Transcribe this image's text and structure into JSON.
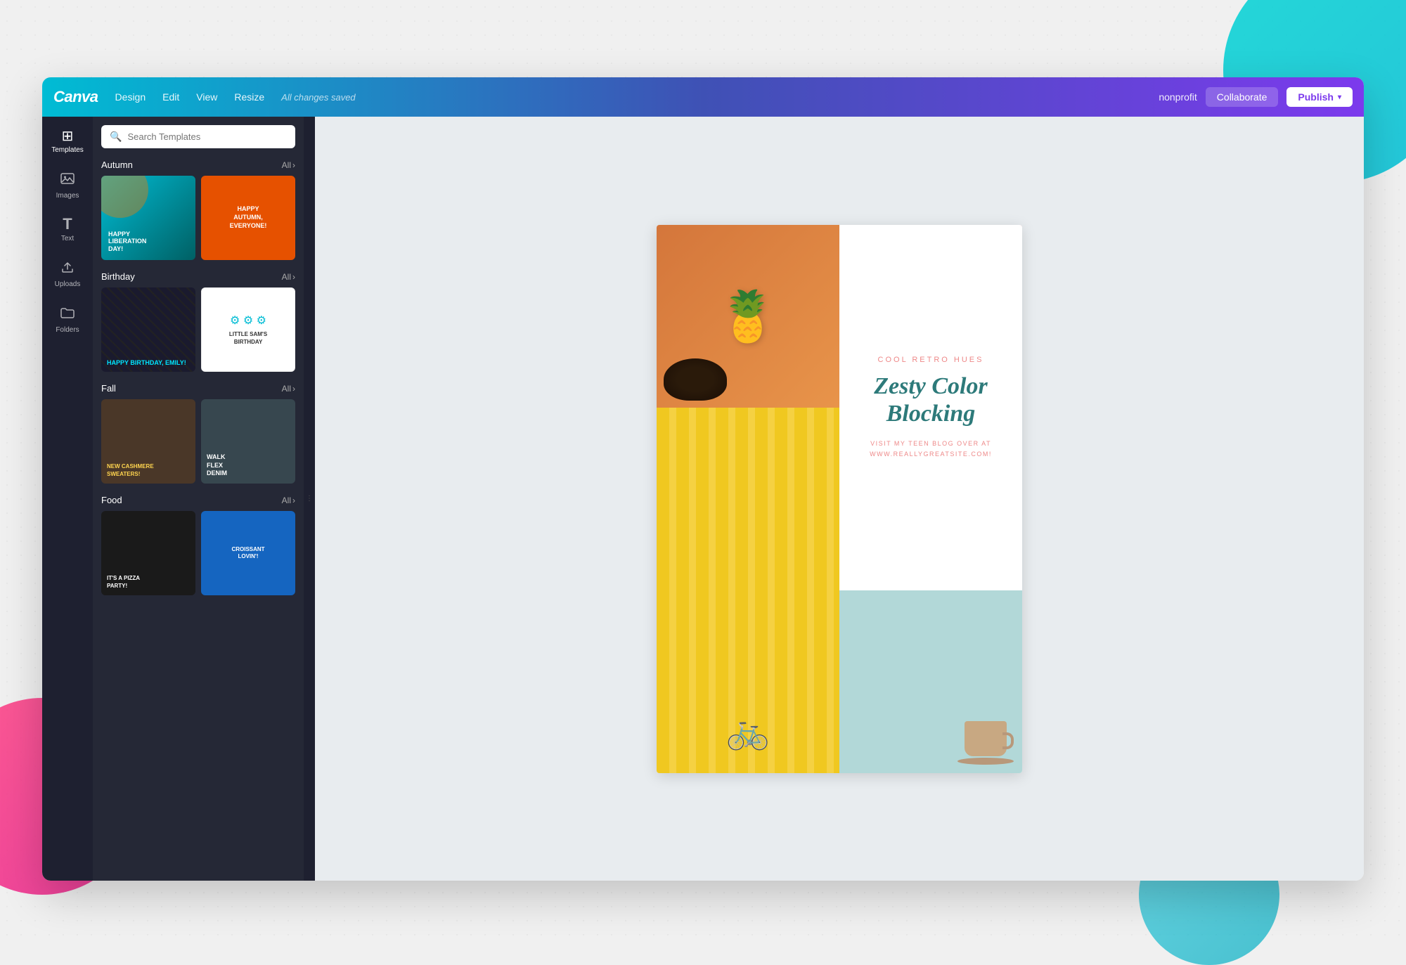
{
  "background": {
    "circles": {
      "teal_top": "teal decorative circle top right",
      "pink_left": "pink decorative circle left",
      "teal_bottom": "teal decorative circle bottom right"
    }
  },
  "navbar": {
    "logo": "Canva",
    "menu": [
      "Design",
      "Edit",
      "View",
      "Resize"
    ],
    "status": "All changes saved",
    "right": {
      "nonprofit": "nonprofit",
      "collaborate": "Collaborate",
      "publish": "Publish",
      "publish_chevron": "▾"
    }
  },
  "icon_sidebar": {
    "items": [
      {
        "icon": "⊞",
        "label": "Templates",
        "active": true
      },
      {
        "icon": "🖼",
        "label": "Images",
        "active": false
      },
      {
        "icon": "T",
        "label": "Text",
        "active": false
      },
      {
        "icon": "⬆",
        "label": "Uploads",
        "active": false
      },
      {
        "icon": "📁",
        "label": "Folders",
        "active": false
      }
    ]
  },
  "templates_panel": {
    "search_placeholder": "Search Templates",
    "categories": [
      {
        "name": "Autumn",
        "all_label": "All",
        "templates": [
          {
            "line1": "HAPPY",
            "line2": "LIBERATION",
            "line3": "DAY!"
          },
          {
            "line1": "HAPPY",
            "line2": "AUTUMN,",
            "line3": "EVERYONE!"
          }
        ]
      },
      {
        "name": "Birthday",
        "all_label": "All",
        "templates": [
          {
            "line1": "HAPPY BIRTHDAY, EMILY!"
          },
          {
            "line1": "LITTLE SAM'S",
            "line2": "BIRTHDAY"
          }
        ]
      },
      {
        "name": "Fall",
        "all_label": "All",
        "templates": [
          {
            "line1": "NEW CASHMERE",
            "line2": "SWEATERS!"
          },
          {
            "line1": "WALK",
            "line2": "FLEX",
            "line3": "DENIM"
          }
        ]
      },
      {
        "name": "Food",
        "all_label": "All",
        "templates": [
          {
            "line1": "IT'S A PIZZA",
            "line2": "PARTY!"
          },
          {
            "line1": "CROISSANT",
            "line2": "LOVIN'!"
          }
        ]
      }
    ]
  },
  "canvas": {
    "subtitle": "COOL RETRO HUES",
    "title": "Zesty Color Blocking",
    "body_line1": "VISIT MY TEEN BLOG OVER AT",
    "body_line2": "WWW.REALLYGREATSITE.COM!"
  }
}
